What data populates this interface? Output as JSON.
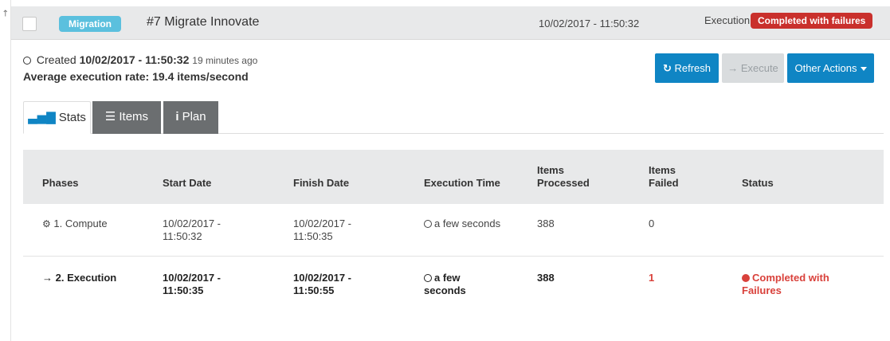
{
  "header": {
    "type_badge": "Migration",
    "title": "#7 Migrate Innovate",
    "date": "10/02/2017 - 11:50:32",
    "execution_label": "Execution",
    "status_badge": "Completed with failures"
  },
  "info": {
    "created_prefix": "Created",
    "created_date": "10/02/2017 - 11:50:32",
    "created_ago": "19 minutes ago",
    "avg_rate": "Average execution rate: 19.4 items/second"
  },
  "actions": {
    "refresh": "Refresh",
    "execute": "Execute",
    "other": "Other Actions"
  },
  "tabs": [
    {
      "label": "Stats",
      "icon": "bar-chart-icon"
    },
    {
      "label": "Items",
      "icon": "list-icon"
    },
    {
      "label": "Plan",
      "icon": "info-icon"
    }
  ],
  "table": {
    "headers": [
      "Phases",
      "Start Date",
      "Finish Date",
      "Execution Time",
      "Items Processed",
      "Items Failed",
      "Status"
    ],
    "header_lines": {
      "items_processed": [
        "Items",
        "Processed"
      ],
      "items_failed": [
        "Items",
        "Failed"
      ]
    },
    "rows": [
      {
        "phase": "1. Compute",
        "phase_icon": "gear-icon",
        "start": [
          "10/02/2017 -",
          "11:50:32"
        ],
        "finish": [
          "10/02/2017 -",
          "11:50:35"
        ],
        "exec_time": "a few seconds",
        "processed": "388",
        "failed": "0",
        "status": ""
      },
      {
        "phase": "2. Execution",
        "phase_icon": "sign-in-icon",
        "start": [
          "10/02/2017 -",
          "11:50:35"
        ],
        "finish": [
          "10/02/2017 -",
          "11:50:55"
        ],
        "exec_time": [
          "a few",
          "seconds"
        ],
        "processed": "388",
        "failed": "1",
        "status": [
          "Completed with",
          "Failures"
        ]
      }
    ]
  },
  "colors": {
    "accent": "#0f85c4",
    "danger": "#d9413b",
    "info": "#5bc0de",
    "tab_dark": "#6b6e70"
  }
}
